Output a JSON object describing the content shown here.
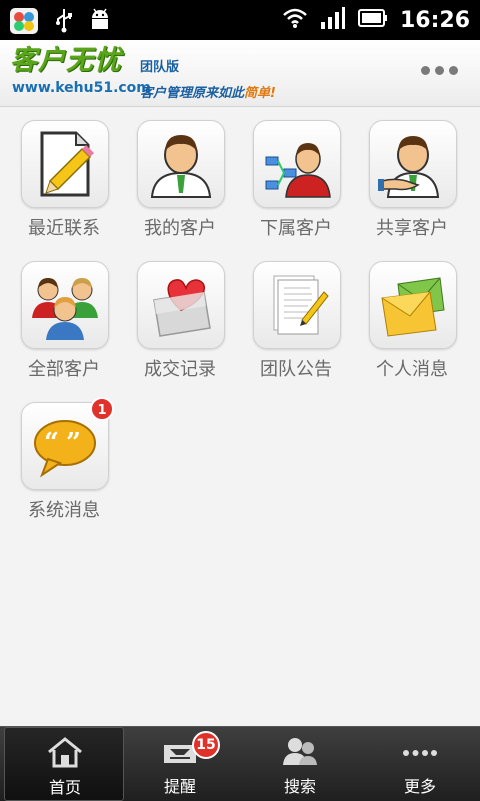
{
  "status_bar": {
    "time": "16:26",
    "icons": [
      "app-store-icon",
      "usb-icon",
      "android-debug-icon",
      "wifi-icon",
      "signal-icon",
      "battery-icon"
    ]
  },
  "header": {
    "brand_name": "客户无忧",
    "brand_url": "www.kehu51.com",
    "edition": "团队版",
    "slogan_prefix": "客户管理原来如此",
    "slogan_highlight": "简单!",
    "menu_icon": "more-dots-icon"
  },
  "grid": {
    "items": [
      {
        "label": "最近联系",
        "icon": "notepad-pencil-icon"
      },
      {
        "label": "我的客户",
        "icon": "person-icon"
      },
      {
        "label": "下属客户",
        "icon": "person-network-icon"
      },
      {
        "label": "共享客户",
        "icon": "handshake-person-icon"
      },
      {
        "label": "全部客户",
        "icon": "group-people-icon"
      },
      {
        "label": "成交记录",
        "icon": "heart-box-icon"
      },
      {
        "label": "团队公告",
        "icon": "document-pen-icon"
      },
      {
        "label": "个人消息",
        "icon": "envelope-icon"
      },
      {
        "label": "系统消息",
        "icon": "speech-bubble-icon",
        "badge": "1"
      }
    ]
  },
  "bottom_nav": {
    "items": [
      {
        "label": "首页",
        "icon": "home-icon",
        "active": true
      },
      {
        "label": "提醒",
        "icon": "inbox-tray-icon",
        "badge": "15"
      },
      {
        "label": "搜索",
        "icon": "people-search-icon"
      },
      {
        "label": "更多",
        "icon": "more-dots-icon"
      }
    ]
  },
  "colors": {
    "brand_green": "#5aa51a",
    "brand_blue": "#1a6fb3",
    "badge_red": "#e0312a",
    "label_gray": "#6a6a6a"
  }
}
